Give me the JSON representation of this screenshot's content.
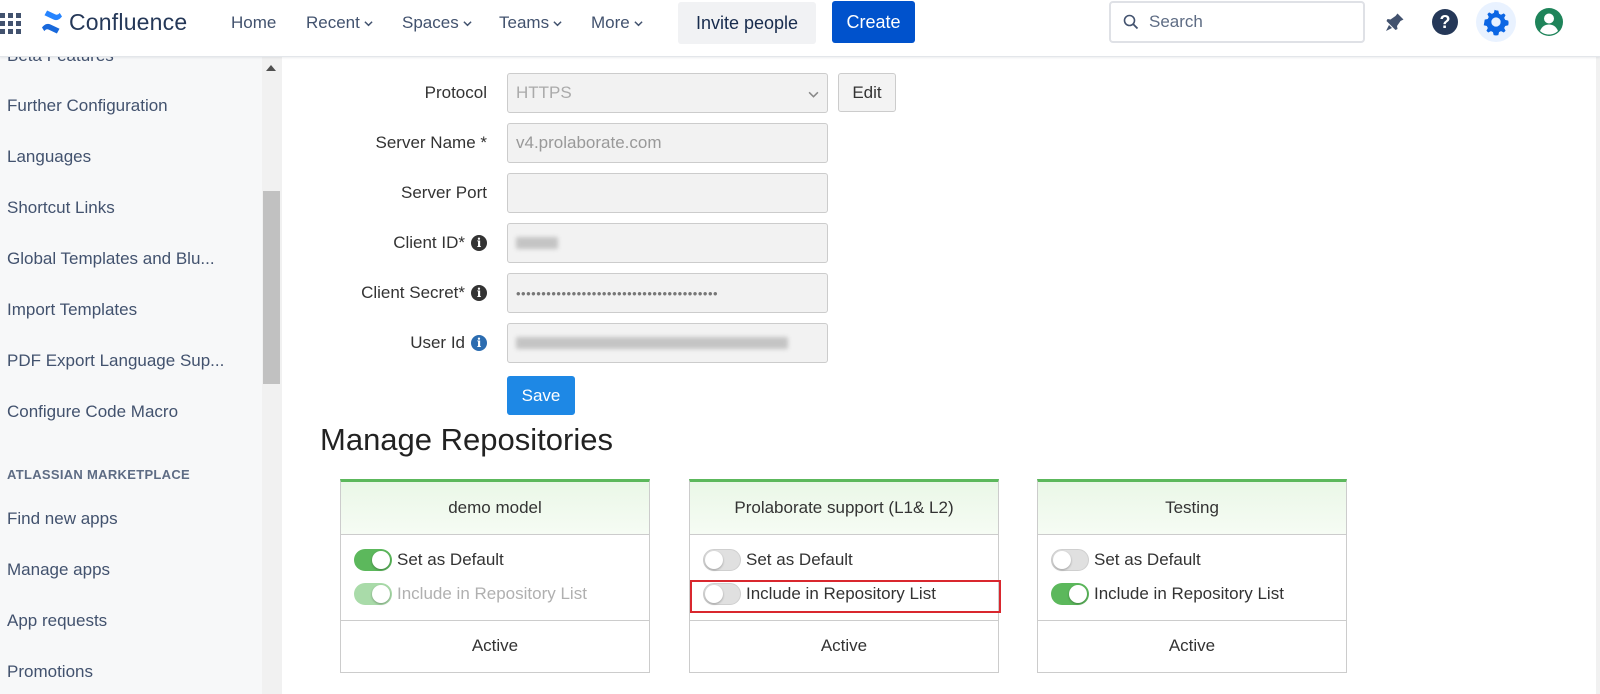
{
  "topnav": {
    "logo_text": "Confluence",
    "items": [
      {
        "label": "Home",
        "has_chevron": false
      },
      {
        "label": "Recent",
        "has_chevron": true
      },
      {
        "label": "Spaces",
        "has_chevron": true
      },
      {
        "label": "Teams",
        "has_chevron": true
      },
      {
        "label": "More",
        "has_chevron": true
      }
    ],
    "invite_label": "Invite people",
    "create_label": "Create",
    "search_placeholder": "Search",
    "icons": [
      "notifications-icon",
      "help-icon",
      "settings-icon",
      "profile-icon"
    ]
  },
  "sidebar": {
    "partial_top_item": "Beta Features",
    "items": [
      "Further Configuration",
      "Languages",
      "Shortcut Links",
      "Global Templates and Blu...",
      "Import Templates",
      "PDF Export Language Sup...",
      "Configure Code Macro"
    ],
    "marketplace_heading": "ATLASSIAN MARKETPLACE",
    "marketplace_items": [
      "Find new apps",
      "Manage apps",
      "App requests",
      "Promotions"
    ]
  },
  "form": {
    "protocol_label": "Protocol",
    "protocol_value": "HTTPS",
    "edit_label": "Edit",
    "server_name_label": "Server Name *",
    "server_name_value": "v4.prolaborate.com",
    "server_port_label": "Server Port",
    "server_port_value": "",
    "client_id_label": "Client ID*",
    "client_secret_label": "Client Secret*",
    "client_secret_value": "••••••••••••••••••••••••••••••••••••••••",
    "user_id_label": "User Id",
    "info_glyph": "i",
    "save_label": "Save"
  },
  "repositories": {
    "title": "Manage Repositories",
    "set_default_label": "Set as Default",
    "include_label": "Include in Repository List",
    "cards": [
      {
        "name": "demo model",
        "set_default": true,
        "include": true,
        "include_disabled": true,
        "status": "Active"
      },
      {
        "name": "Prolaborate support (L1& L2)",
        "set_default": false,
        "include": false,
        "include_disabled": false,
        "status": "Active"
      },
      {
        "name": "Testing",
        "set_default": false,
        "include": true,
        "include_disabled": false,
        "status": "Active"
      }
    ]
  },
  "colors": {
    "brand_blue": "#0052cc",
    "save_blue": "#1e88e5",
    "toggle_on": "#5cb85c",
    "highlight_red": "#d9272e",
    "info_blue": "#2b6cb0"
  }
}
